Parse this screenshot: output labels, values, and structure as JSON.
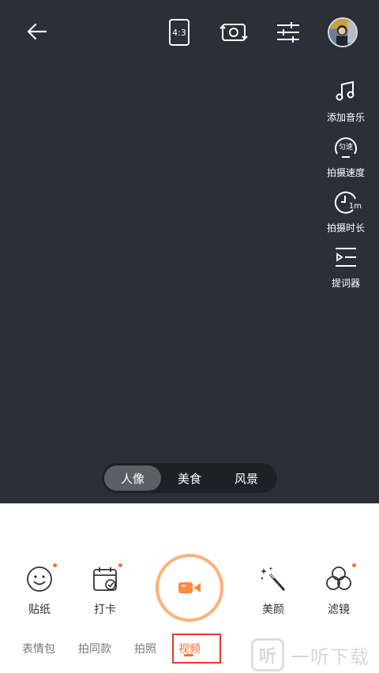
{
  "topbar": {
    "back_icon": "arrow-left-icon",
    "ratio_label": "4:3",
    "flip_icon": "camera-flip-icon",
    "settings_icon": "sliders-icon"
  },
  "side_tools": [
    {
      "label": "添加音乐",
      "icon": "music-note-icon"
    },
    {
      "label": "拍摄速度",
      "icon": "speed-gauge-icon",
      "badge": "匀速"
    },
    {
      "label": "拍摄时长",
      "icon": "clock-icon",
      "badge": "1m"
    },
    {
      "label": "提词器",
      "icon": "teleprompter-icon"
    }
  ],
  "scenes": [
    {
      "label": "人像",
      "active": true
    },
    {
      "label": "美食",
      "active": false
    },
    {
      "label": "风景",
      "active": false
    }
  ],
  "bottom_tools": {
    "sticker": "贴纸",
    "checkin": "打卡",
    "beauty": "美颜",
    "filter": "滤镜"
  },
  "modes": [
    {
      "label": "表情包",
      "active": false
    },
    {
      "label": "拍同款",
      "active": false
    },
    {
      "label": "拍照",
      "active": false
    },
    {
      "label": "视频",
      "active": true
    }
  ],
  "watermark": {
    "logo": "听",
    "text": "一听下载"
  },
  "colors": {
    "viewfinder_bg": "#2b2f38",
    "accent": "#ff6a2d",
    "highlight_box": "#e23a2f",
    "shutter_ring": "#ffb07a"
  }
}
